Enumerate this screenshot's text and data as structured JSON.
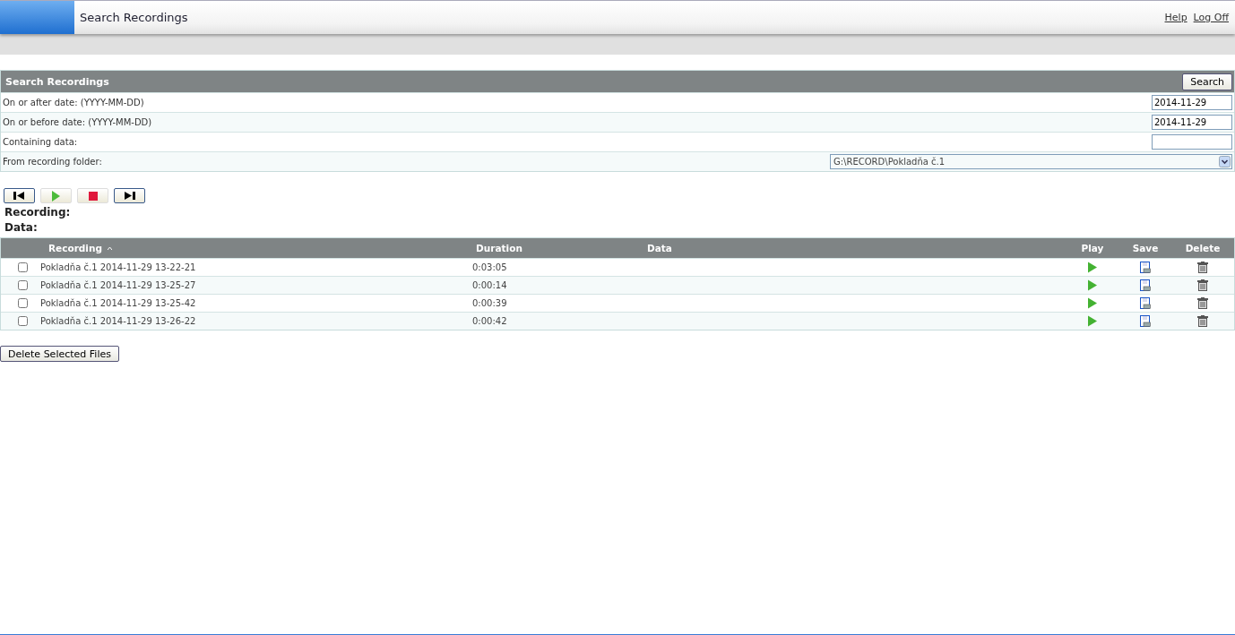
{
  "header": {
    "title": "Search Recordings",
    "links": [
      "Help",
      "Log Off"
    ]
  },
  "search": {
    "title": "Search Recordings",
    "button": "Search",
    "fields": [
      {
        "kind": "text",
        "label": "On or after date: (YYYY-MM-DD)",
        "value": "2014-11-29"
      },
      {
        "kind": "text",
        "label": "On or before date: (YYYY-MM-DD)",
        "value": "2014-11-29"
      },
      {
        "kind": "text",
        "label": "Containing data:"
      },
      {
        "kind": "select",
        "label": "From recording folder:",
        "value": "G:\\RECORD\\Pokladňa č.1"
      }
    ]
  },
  "player": {
    "recording_label": "Recording:",
    "data_label": "Data:"
  },
  "table": {
    "columns": [
      "Recording",
      "Duration",
      "Data",
      "Play",
      "Save",
      "Delete"
    ],
    "rows": [
      {
        "recording": "Pokladňa č.1 2014-11-29 13-22-21",
        "duration": "0:03:05",
        "checked": false
      },
      {
        "recording": "Pokladňa č.1 2014-11-29 13-25-27",
        "duration": "0:00:14",
        "checked": false
      },
      {
        "recording": "Pokladňa č.1 2014-11-29 13-25-42",
        "duration": "0:00:39",
        "checked": false
      },
      {
        "recording": "Pokladňa č.1 2014-11-29 13-26-22",
        "duration": "0:00:42",
        "checked": false
      }
    ]
  },
  "delete_button": "Delete Selected Files"
}
